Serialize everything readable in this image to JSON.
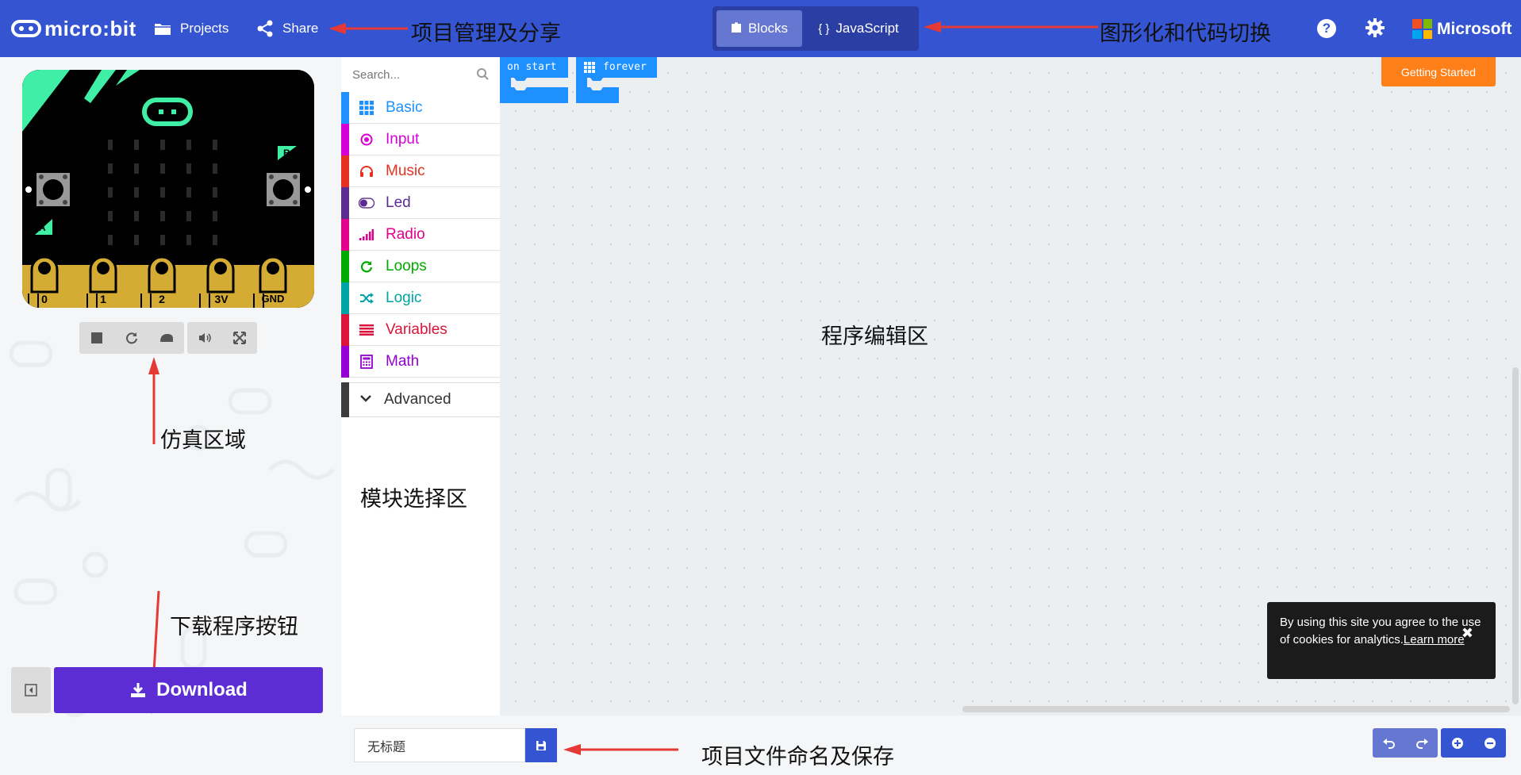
{
  "brand": {
    "logo_text": "micro:bit",
    "vendor": "Microsoft"
  },
  "header": {
    "projects_label": "Projects",
    "share_label": "Share",
    "blocks_label": "Blocks",
    "javascript_label": "JavaScript",
    "icons": [
      "folder-icon",
      "share-icon",
      "puzzle-icon",
      "braces-icon",
      "help-icon",
      "gear-icon"
    ]
  },
  "annotations": {
    "project_share": "项目管理及分享",
    "mode_switch": "图形化和代码切换",
    "simulator": "仿真区域",
    "toolbox": "模块选择区",
    "editor": "程序编辑区",
    "download": "下载程序按钮",
    "file_name": "项目文件命名及保存"
  },
  "simulator": {
    "pins": [
      "0",
      "1",
      "2",
      "3V",
      "GND"
    ],
    "button_a": "A",
    "button_b": "B",
    "controls": [
      "stop-icon",
      "restart-icon",
      "slowmo-icon",
      "mute-icon",
      "fullscreen-icon"
    ]
  },
  "toolbox": {
    "search_placeholder": "Search...",
    "categories": [
      {
        "label": "Basic",
        "color": "#1e90ff",
        "icon": "grid-icon"
      },
      {
        "label": "Input",
        "color": "#d400d4",
        "icon": "target-icon"
      },
      {
        "label": "Music",
        "color": "#e63022",
        "icon": "headphones-icon"
      },
      {
        "label": "Led",
        "color": "#5c2d91",
        "icon": "toggle-icon"
      },
      {
        "label": "Radio",
        "color": "#e3008c",
        "icon": "signal-icon"
      },
      {
        "label": "Loops",
        "color": "#00aa00",
        "icon": "refresh-icon"
      },
      {
        "label": "Logic",
        "color": "#00a4a6",
        "icon": "shuffle-icon"
      },
      {
        "label": "Variables",
        "color": "#dc143c",
        "icon": "list-icon"
      },
      {
        "label": "Math",
        "color": "#9400d3",
        "icon": "calculator-icon"
      }
    ],
    "advanced_label": "Advanced"
  },
  "workspace": {
    "blocks": [
      {
        "label": "on start"
      },
      {
        "label": "forever"
      }
    ],
    "block_color": "#1e90ff"
  },
  "getting_started_label": "Getting Started",
  "cookie": {
    "text": "By using this site you agree to the use of cookies for analytics.",
    "link": "Learn more"
  },
  "download_label": "Download",
  "project": {
    "name": "无标题"
  },
  "colors": {
    "header": "#3454d1",
    "download": "#5c2dd2",
    "getting_started": "#ff7f18"
  }
}
